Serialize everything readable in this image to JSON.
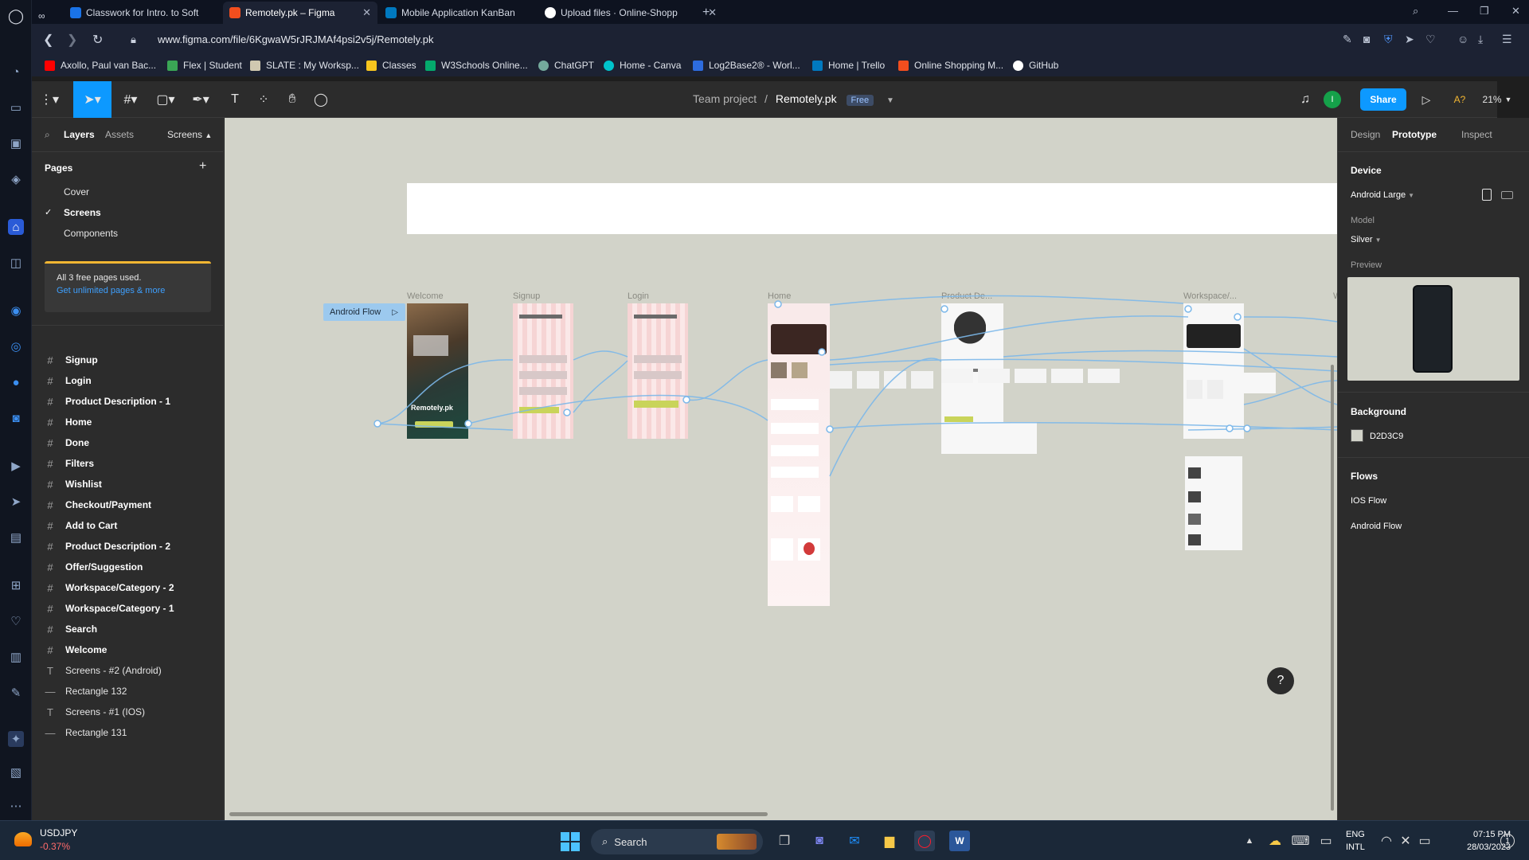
{
  "browser": {
    "tabs": [
      {
        "title": "Classwork for Intro. to Soft",
        "fav_color": "#1a73e8"
      },
      {
        "title": "Remotely.pk – Figma",
        "fav_color": "#f24e1e"
      },
      {
        "title": "Mobile Application KanBan",
        "fav_color": "#0079bf"
      },
      {
        "title": "Upload files · Online-Shopp",
        "fav_color": "#ffffff"
      }
    ],
    "new_tab": "+",
    "url": "www.figma.com/file/6KgwaW5rJRJMAf4psi2v5j/Remotely.pk",
    "bookmarks": [
      {
        "label": "Axollo, Paul van Bac...",
        "color": "#ff0000"
      },
      {
        "label": "Flex | Student",
        "color": "#3aa655"
      },
      {
        "label": "SLATE : My Worksp...",
        "color": "#d0c8b0"
      },
      {
        "label": "Classes",
        "color": "#f7c51e"
      },
      {
        "label": "W3Schools Online...",
        "color": "#04aa6d"
      },
      {
        "label": "ChatGPT",
        "color": "#74aa9c"
      },
      {
        "label": "Home - Canva",
        "color": "#00c4cc"
      },
      {
        "label": "Log2Base2® - Worl...",
        "color": "#2d6cdf"
      },
      {
        "label": "Home | Trello",
        "color": "#0079bf"
      },
      {
        "label": "Online Shopping M...",
        "color": "#f24e1e"
      },
      {
        "label": "GitHub",
        "color": "#ffffff"
      }
    ]
  },
  "figma": {
    "breadcrumb_team": "Team project",
    "separator": "/",
    "file_name": "Remotely.pk",
    "plan_badge": "Free",
    "share_label": "Share",
    "avatar_initial": "I",
    "zoom": "21%",
    "font_warning": "A?"
  },
  "left_panel": {
    "tabs": [
      "Layers",
      "Assets"
    ],
    "pages_dropdown": "Screens",
    "pages_title": "Pages",
    "pages": [
      "Cover",
      "Screens",
      "Components"
    ],
    "current_page": "Screens",
    "notice_line1": "All 3 free pages used.",
    "notice_line2": "Get unlimited pages & more",
    "layers": [
      {
        "name": "Signup",
        "type": "frame"
      },
      {
        "name": "Login",
        "type": "frame"
      },
      {
        "name": "Product Description - 1",
        "type": "frame"
      },
      {
        "name": "Home",
        "type": "frame"
      },
      {
        "name": "Done",
        "type": "frame"
      },
      {
        "name": "Filters",
        "type": "frame"
      },
      {
        "name": "Wishlist",
        "type": "frame"
      },
      {
        "name": "Checkout/Payment",
        "type": "frame"
      },
      {
        "name": "Add to Cart",
        "type": "frame"
      },
      {
        "name": "Product Description - 2",
        "type": "frame"
      },
      {
        "name": "Offer/Suggestion",
        "type": "frame"
      },
      {
        "name": "Workspace/Category - 2",
        "type": "frame"
      },
      {
        "name": "Workspace/Category - 1",
        "type": "frame"
      },
      {
        "name": "Search",
        "type": "frame"
      },
      {
        "name": "Welcome",
        "type": "frame"
      },
      {
        "name": "Screens - #2 (Android)",
        "type": "text"
      },
      {
        "name": "Rectangle 132",
        "type": "rect"
      },
      {
        "name": "Screens - #1 (IOS)",
        "type": "text"
      },
      {
        "name": "Rectangle 131",
        "type": "rect"
      }
    ]
  },
  "canvas": {
    "background": "#D2D3C9",
    "flow_start_label": "Android Flow",
    "frame_labels": [
      "Welcome",
      "Signup",
      "Login",
      "Home",
      "Product De...",
      "Workspace/...",
      "W"
    ],
    "welcome_brand": "Remotely.pk"
  },
  "right_panel": {
    "tabs": [
      "Design",
      "Prototype",
      "Inspect"
    ],
    "active_tab": "Prototype",
    "device_title": "Device",
    "device_value": "Android Large",
    "model_label": "Model",
    "model_value": "Silver",
    "preview_label": "Preview",
    "background_title": "Background",
    "background_value": "D2D3C9",
    "flows_title": "Flows",
    "flows": [
      "IOS Flow",
      "Android Flow"
    ]
  },
  "taskbar": {
    "ticker_symbol": "USDJPY",
    "ticker_change": "-0.37%",
    "search_label": "Search",
    "lang_line1": "ENG",
    "lang_line2": "INTL",
    "time": "07:15 PM",
    "date": "28/03/2023",
    "notification_count": "1"
  }
}
